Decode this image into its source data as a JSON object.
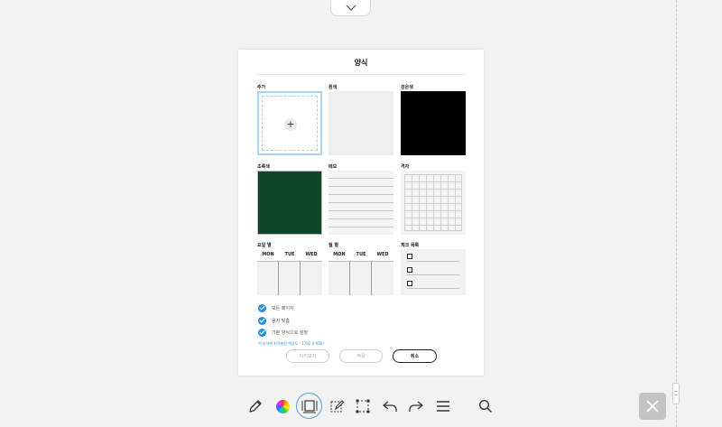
{
  "dialog": {
    "title": "양식",
    "templates": [
      {
        "label": "추가",
        "kind": "add"
      },
      {
        "label": "흰색",
        "kind": "white"
      },
      {
        "label": "검은색",
        "kind": "black"
      },
      {
        "label": "초록색",
        "kind": "green"
      },
      {
        "label": "메모",
        "kind": "memo"
      },
      {
        "label": "격자",
        "kind": "grid"
      },
      {
        "label": "요일 별",
        "kind": "weekday",
        "days": [
          "MON",
          "TUE",
          "WED"
        ]
      },
      {
        "label": "월 별",
        "kind": "monthly",
        "days": [
          "MON",
          "TUE",
          "WED"
        ]
      },
      {
        "label": "체크 목록",
        "kind": "checklist"
      }
    ],
    "options": [
      {
        "label": "모든 페이지",
        "checked": true
      },
      {
        "label": "용지 맞춤",
        "checked": true
      },
      {
        "label": "기본 양식으로 설정",
        "checked": true
      }
    ],
    "note": "이 양식에 최적화된 해상도 : 1782 X 936)",
    "buttons": {
      "preview": "미리보기",
      "apply": "적용",
      "cancel": "취소"
    }
  },
  "colors": {
    "accent": "#1e8fe1",
    "green_board": "#0f4528"
  },
  "toolbar": {
    "icons": [
      "pen-icon",
      "color-wheel-icon",
      "template-icon",
      "edit-page-icon",
      "select-area-icon",
      "undo-icon",
      "redo-icon",
      "menu-icon",
      "search-icon"
    ],
    "active": "template-icon"
  }
}
